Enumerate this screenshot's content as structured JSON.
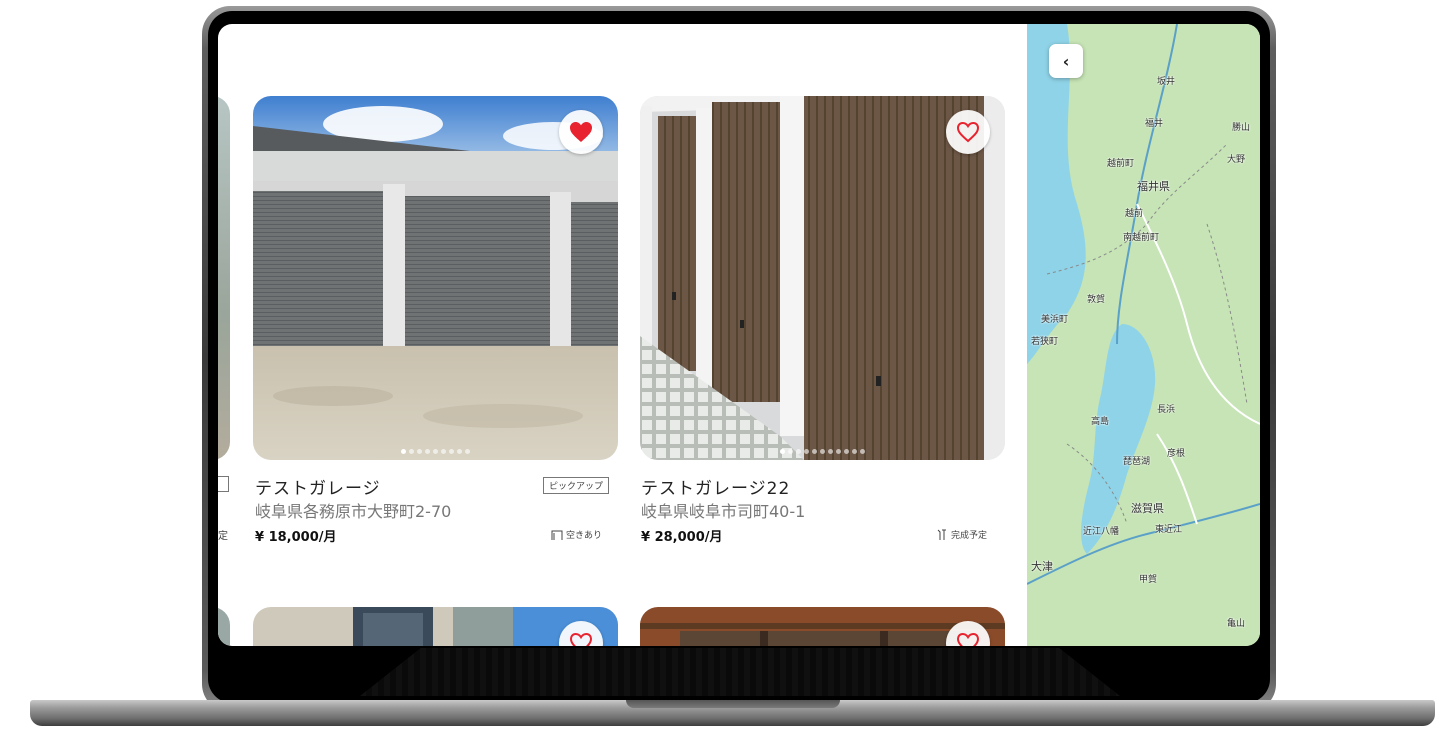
{
  "listings": [
    {
      "title": "テストガレージ",
      "address": "岐阜県各務原市大野町2-70",
      "price": "¥ 18,000/月",
      "status": "空きあり",
      "badge": "ピックアップ",
      "favorited": true,
      "photo_dots": 9,
      "active_dot": 0
    },
    {
      "title": "テストガレージ22",
      "address": "岐阜県岐阜市司町40-1",
      "price": "¥ 28,000/月",
      "status": "完成予定",
      "badge": "",
      "favorited": false,
      "photo_dots": 11,
      "active_dot": 0
    }
  ],
  "left_partial": {
    "status_tail": "定"
  },
  "map": {
    "back_icon": "chevron-left",
    "place_labels": [
      "福井",
      "越前町",
      "福井県",
      "越前",
      "南越前町",
      "敦賀",
      "美浜町",
      "若狭町",
      "高島",
      "長浜",
      "彦根",
      "琵琶湖",
      "滋賀県",
      "近江八幡",
      "東近江",
      "甲賀",
      "大津",
      "大野",
      "勝山",
      "亀山",
      "坂井"
    ]
  },
  "colors": {
    "heart_active": "#e8222e",
    "heart_outline": "#e8222e",
    "map_land": "#c6e4b5",
    "map_water": "#8fd3e8"
  }
}
